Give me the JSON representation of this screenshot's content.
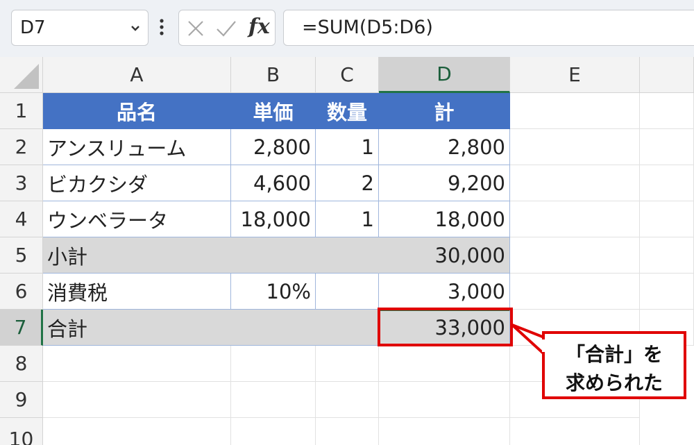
{
  "formula_bar": {
    "name_box": "D7",
    "formula": "=SUM(D5:D6)",
    "fx_label": "fx"
  },
  "columns": [
    "A",
    "B",
    "C",
    "D",
    "E"
  ],
  "rows": [
    "1",
    "2",
    "3",
    "4",
    "5",
    "6",
    "7",
    "8",
    "9",
    "10"
  ],
  "table": {
    "header": [
      "品名",
      "単価",
      "数量",
      "計"
    ],
    "items": [
      [
        "アンスリューム",
        "2,800",
        "1",
        "2,800"
      ],
      [
        "ビカクシダ",
        "4,600",
        "2",
        "9,200"
      ],
      [
        "ウンベラータ",
        "18,000",
        "1",
        "18,000"
      ]
    ],
    "subtotal": {
      "label": "小計",
      "value": "30,000"
    },
    "tax": {
      "label": "消費税",
      "rate": "10%",
      "value": "3,000"
    },
    "total": {
      "label": "合計",
      "value": "33,000"
    }
  },
  "callout": {
    "line1": "「合計」を",
    "line2": "求められた"
  },
  "colors": {
    "header_fill": "#4472c4",
    "summary_fill": "#d9d9d9",
    "highlight": "#e00000",
    "selection": "#217346"
  }
}
